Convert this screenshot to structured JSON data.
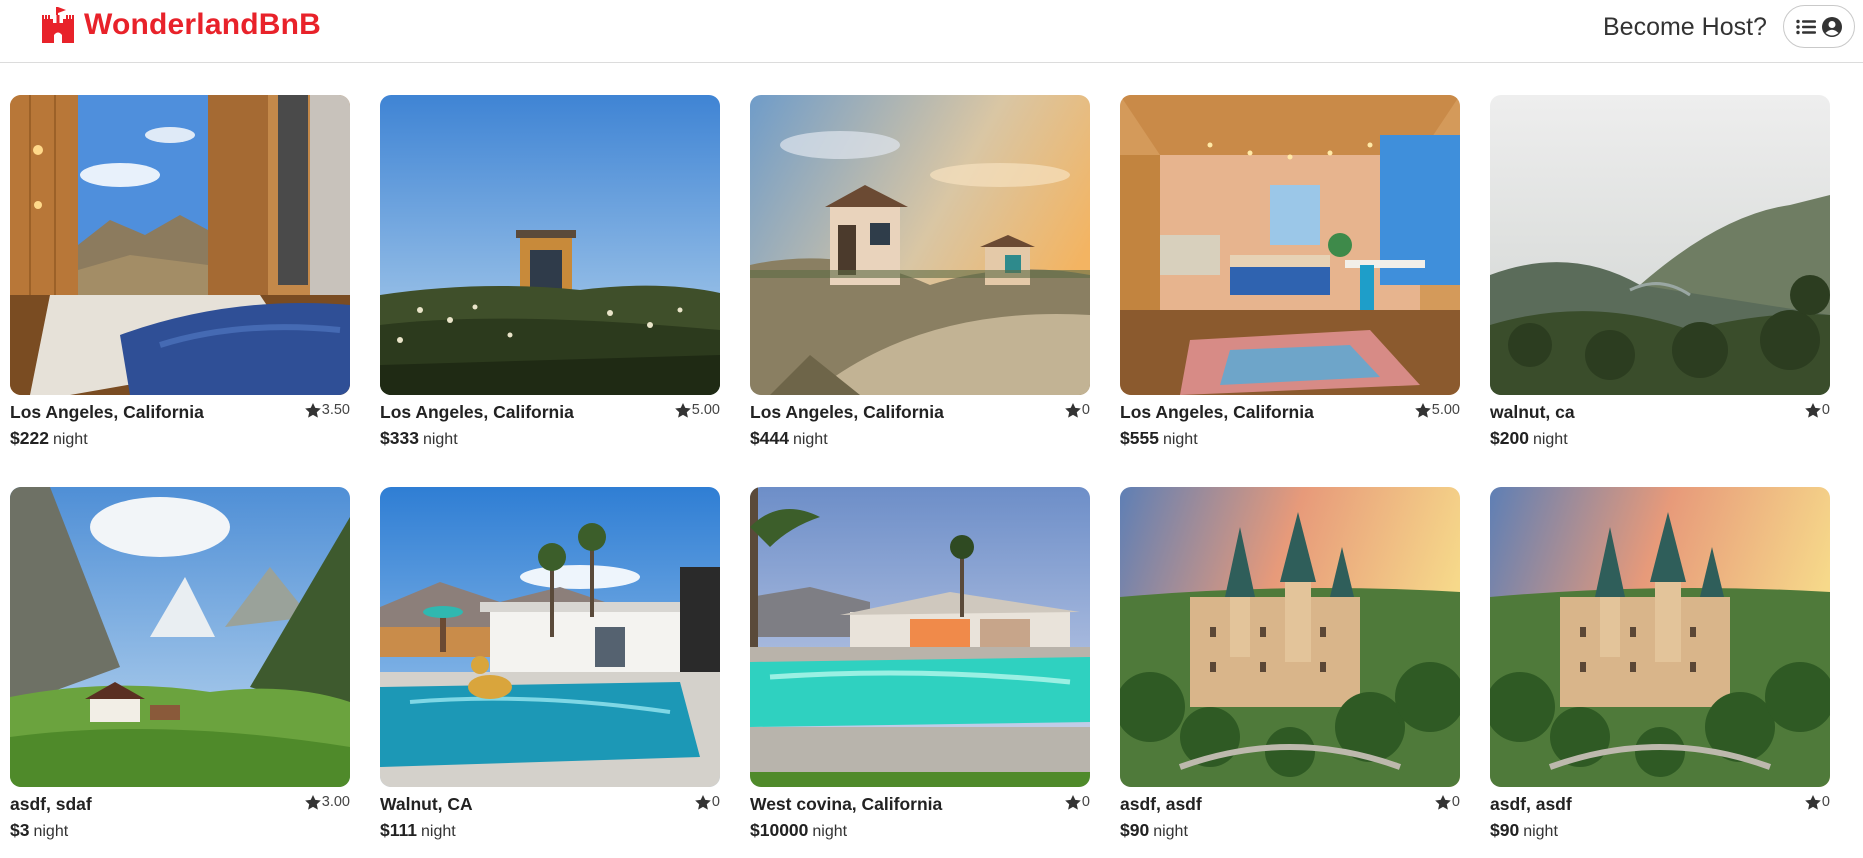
{
  "header": {
    "brand": "WonderlandBnB",
    "become_host": "Become Host?",
    "brand_color": "#e8222a",
    "icons": [
      "castle-logo-icon",
      "menu-list-icon",
      "user-circle-icon"
    ]
  },
  "listings": [
    {
      "location": "Los Angeles, California",
      "rating": "3.50",
      "price": "$222",
      "unit": "night",
      "image": "cabin-interior-window-view"
    },
    {
      "location": "Los Angeles, California",
      "rating": "5.00",
      "price": "$333",
      "unit": "night",
      "image": "tiny-cabin-meadow-blue-sky"
    },
    {
      "location": "Los Angeles, California",
      "rating": "0",
      "price": "$444",
      "unit": "night",
      "image": "hillside-cabins-sunset"
    },
    {
      "location": "Los Angeles, California",
      "rating": "5.00",
      "price": "$555",
      "unit": "night",
      "image": "cozy-tiny-house-interior"
    },
    {
      "location": "walnut, ca",
      "rating": "0",
      "price": "$200",
      "unit": "night",
      "image": "misty-mountain-cliffs"
    },
    {
      "location": "asdf, sdaf",
      "rating": "3.00",
      "price": "$3",
      "unit": "night",
      "image": "alpine-valley-chalet"
    },
    {
      "location": "Walnut, CA",
      "rating": "0",
      "price": "$111",
      "unit": "night",
      "image": "pool-house-palm-trees"
    },
    {
      "location": "West covina, California",
      "rating": "0",
      "price": "$10000",
      "unit": "night",
      "image": "modern-house-pool-dusk"
    },
    {
      "location": "asdf, asdf",
      "rating": "0",
      "price": "$90",
      "unit": "night",
      "image": "castle-forest-sunset"
    },
    {
      "location": "asdf, asdf",
      "rating": "0",
      "price": "$90",
      "unit": "night",
      "image": "castle-forest-sunset"
    }
  ]
}
